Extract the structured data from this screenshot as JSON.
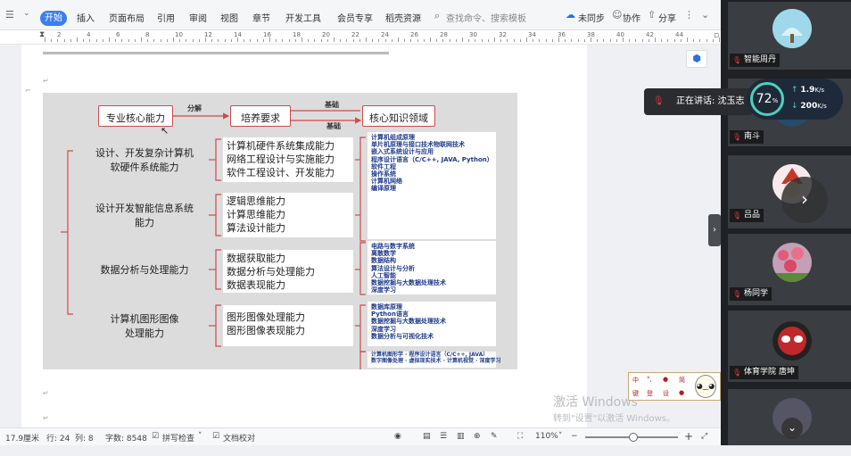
{
  "menubar": {
    "tabs": [
      "开始",
      "插入",
      "页面布局",
      "引用",
      "审阅",
      "视图",
      "章节",
      "开发工具",
      "会员专享",
      "稻壳资源"
    ],
    "search_placeholder": "查找命令、搜索模板",
    "sync": "未同步",
    "collab": "协作",
    "share": "分享"
  },
  "ruler": {
    "numbers": [
      "2",
      "4",
      "6",
      "8",
      "10",
      "12",
      "14",
      "16",
      "18",
      "20",
      "22",
      "24",
      "26",
      "28",
      "30",
      "32",
      "34",
      "36",
      "38",
      "40",
      "42",
      "44"
    ]
  },
  "diagram": {
    "top": {
      "left": "专业核心能力",
      "mid": "培养要求",
      "right": "核心知识领域",
      "arrow1": "分解",
      "arrow2a": "基础",
      "arrow2b": "基础"
    },
    "rows": [
      {
        "title": [
          "设计、开发复杂计算机",
          "软硬件系统能力"
        ],
        "abilities": [
          "计算机硬件系统集成能力",
          "网络工程设计与实施能力",
          "软件工程设计、开发能力"
        ],
        "knowledge": [
          "计算机组成原理",
          "单片机原理与接口技术物联网技术",
          "嵌入式系统设计与应用",
          "程序设计语言（C/C++, JAVA, Python）",
          "软件工程",
          "操作系统",
          "计算机网络",
          "编译原理"
        ]
      },
      {
        "title": [
          "设计开发智能信息系统",
          "能力"
        ],
        "abilities": [
          "逻辑思维能力",
          "计算思维能力",
          "算法设计能力"
        ],
        "knowledge": [
          "电路与数字系统",
          "离散数学",
          "数据结构",
          "算法设计与分析",
          "人工智能",
          "数据挖掘与大数据处理技术",
          "深度学习"
        ]
      },
      {
        "title": [
          "数据分析与处理能力"
        ],
        "abilities": [
          "数据获取能力",
          "数据分析与处理能力",
          "数据表现能力"
        ],
        "knowledge": [
          "数据库原理",
          "Python语言",
          "数据挖掘与大数据处理技术",
          "深度学习",
          "数据分析与可视化技术"
        ]
      },
      {
        "title": [
          "计算机图形图像",
          "处理能力"
        ],
        "abilities": [
          "图形图像处理能力",
          "图形图像表现能力"
        ],
        "knowledge": [
          "计算机图形学",
          "程序设计语言（C/C++, JAVA）",
          "数字图像处理",
          "虚拟现实技术",
          "计算机视觉",
          "深度学习"
        ]
      }
    ]
  },
  "watermark": {
    "title": "激活 Windows",
    "sub": "转到\"设置\"以激活 Windows。"
  },
  "ime": {
    "chars": [
      "中",
      "°,",
      "●",
      "简",
      "键",
      "登",
      "设",
      "●"
    ]
  },
  "statusbar": {
    "page_size": "17.9厘米",
    "row": "行: 24",
    "col": "列: 8",
    "word_count": "字数: 8548",
    "spell_check": "拼写检查",
    "proofread": "文档校对",
    "zoom": "110%",
    "zoom_fraction": 0.52
  },
  "meeting": {
    "participants": [
      "智能周丹",
      "南斗",
      "吕品",
      "杨同学",
      "体育学院  唐坤"
    ],
    "speaking": "正在讲话: 沈玉志",
    "net_percent": "72",
    "net_percent_unit": "%",
    "upload": "1.9",
    "download": "200",
    "speed_unit": "K/s"
  }
}
